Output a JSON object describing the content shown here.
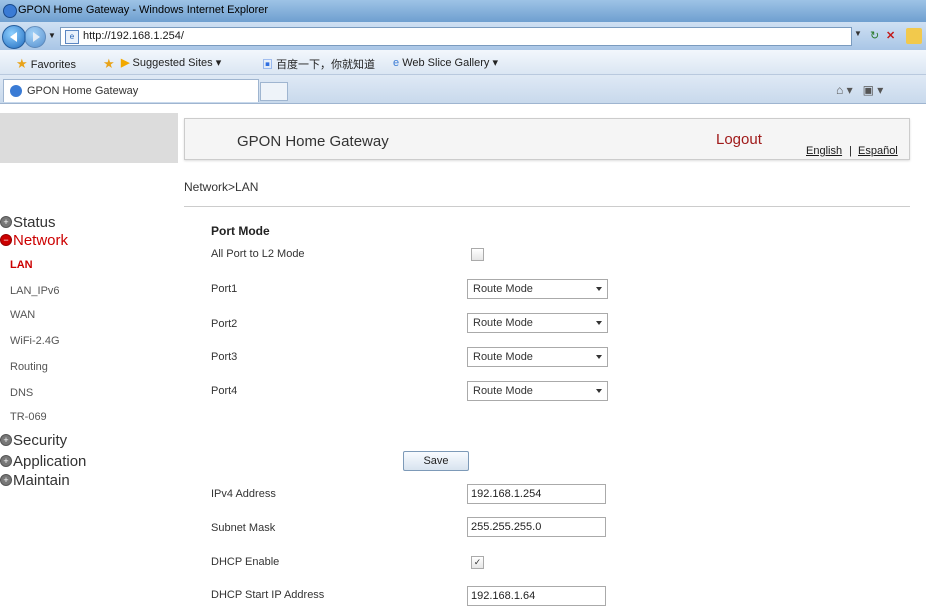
{
  "window": {
    "title": "GPON Home Gateway - Windows Internet Explorer"
  },
  "address_bar": {
    "url": "http://192.168.1.254/"
  },
  "favorites_bar": {
    "favorites_label": "Favorites",
    "suggested_sites": "Suggested Sites ▾",
    "baidu": "百度一下，你就知道",
    "web_slice": "Web Slice Gallery ▾"
  },
  "tab": {
    "title": "GPON Home Gateway"
  },
  "header": {
    "title": "GPON Home Gateway",
    "logout": "Logout",
    "lang_english": "English",
    "lang_sep": "|",
    "lang_spanish": "Español"
  },
  "breadcrumb": "Network>LAN",
  "sidebar": {
    "groups": [
      {
        "label": "Status",
        "icon": "plus-icon"
      },
      {
        "label": "Network",
        "icon": "minus-icon"
      },
      {
        "label": "Security",
        "icon": "plus-icon"
      },
      {
        "label": "Application",
        "icon": "plus-icon"
      },
      {
        "label": "Maintain",
        "icon": "plus-icon"
      }
    ],
    "network_items": [
      "LAN",
      "LAN_IPv6",
      "WAN",
      "WiFi-2.4G",
      "Routing",
      "DNS",
      "TR-069"
    ]
  },
  "form": {
    "section_title": "Port Mode",
    "all_port_label": "All Port to L2 Mode",
    "all_port_checked": false,
    "ports": [
      {
        "label": "Port1",
        "value": "Route Mode"
      },
      {
        "label": "Port2",
        "value": "Route Mode"
      },
      {
        "label": "Port3",
        "value": "Route Mode"
      },
      {
        "label": "Port4",
        "value": "Route Mode"
      }
    ],
    "save_label": "Save",
    "ipv4_label": "IPv4 Address",
    "ipv4_value": "192.168.1.254",
    "subnet_label": "Subnet Mask",
    "subnet_value": "255.255.255.0",
    "dhcp_label": "DHCP Enable",
    "dhcp_checked": true,
    "dhcp_start_label": "DHCP Start IP Address",
    "dhcp_start_value": "192.168.1.64"
  },
  "colors": {
    "accent": "#cc0000",
    "logout": "#a01a1a"
  }
}
